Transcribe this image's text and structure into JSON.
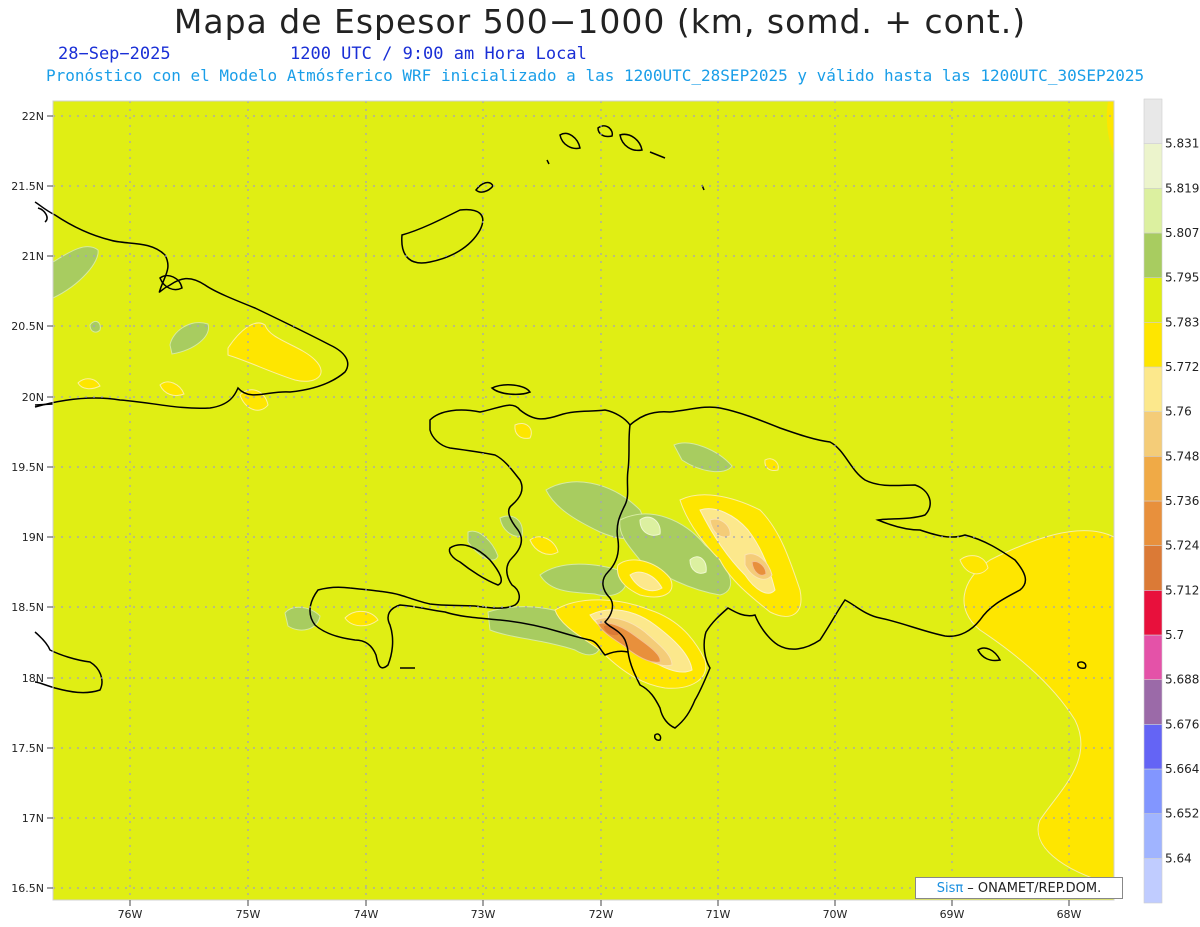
{
  "header": {
    "title": "Mapa de Espesor 500−1000 (km, somd. + cont.)",
    "date": "28−Sep−2025",
    "time": "1200 UTC / 9:00 am Hora Local",
    "model_line": "Pronóstico con el Modelo Atmósferico WRF inicializado a las 1200UTC_28SEP2025 y válido hasta las  1200UTC_30SEP2025"
  },
  "map": {
    "lat_labels": [
      "22N",
      "21.5N",
      "21N",
      "20.5N",
      "20N",
      "19.5N",
      "19N",
      "18.5N",
      "18N",
      "17.5N",
      "17N",
      "16.5N"
    ],
    "lon_labels": [
      "76W",
      "75W",
      "74W",
      "73W",
      "72W",
      "71W",
      "70W",
      "69W",
      "68W"
    ],
    "base_color": "#e0ee14"
  },
  "legend": {
    "levels": [
      "5.64",
      "5.652",
      "5.664",
      "5.676",
      "5.688",
      "5.7",
      "5.712",
      "5.724",
      "5.736",
      "5.748",
      "5.76",
      "5.772",
      "5.783",
      "5.795",
      "5.807",
      "5.819",
      "5.831"
    ],
    "colors": [
      "#c0ccff",
      "#a0b4ff",
      "#8296ff",
      "#6464f5",
      "#9b6aa8",
      "#e452a8",
      "#e8103c",
      "#db7a36",
      "#e8903c",
      "#f0aa46",
      "#f4cc78",
      "#fce88c",
      "#fee600",
      "#e0ee14",
      "#a8cc60",
      "#dcf0a0",
      "#ecf4cc",
      "#e8e8e8"
    ]
  },
  "credit": {
    "brand": "Sisπ",
    "text": "– ONAMET/REP.DOM."
  }
}
